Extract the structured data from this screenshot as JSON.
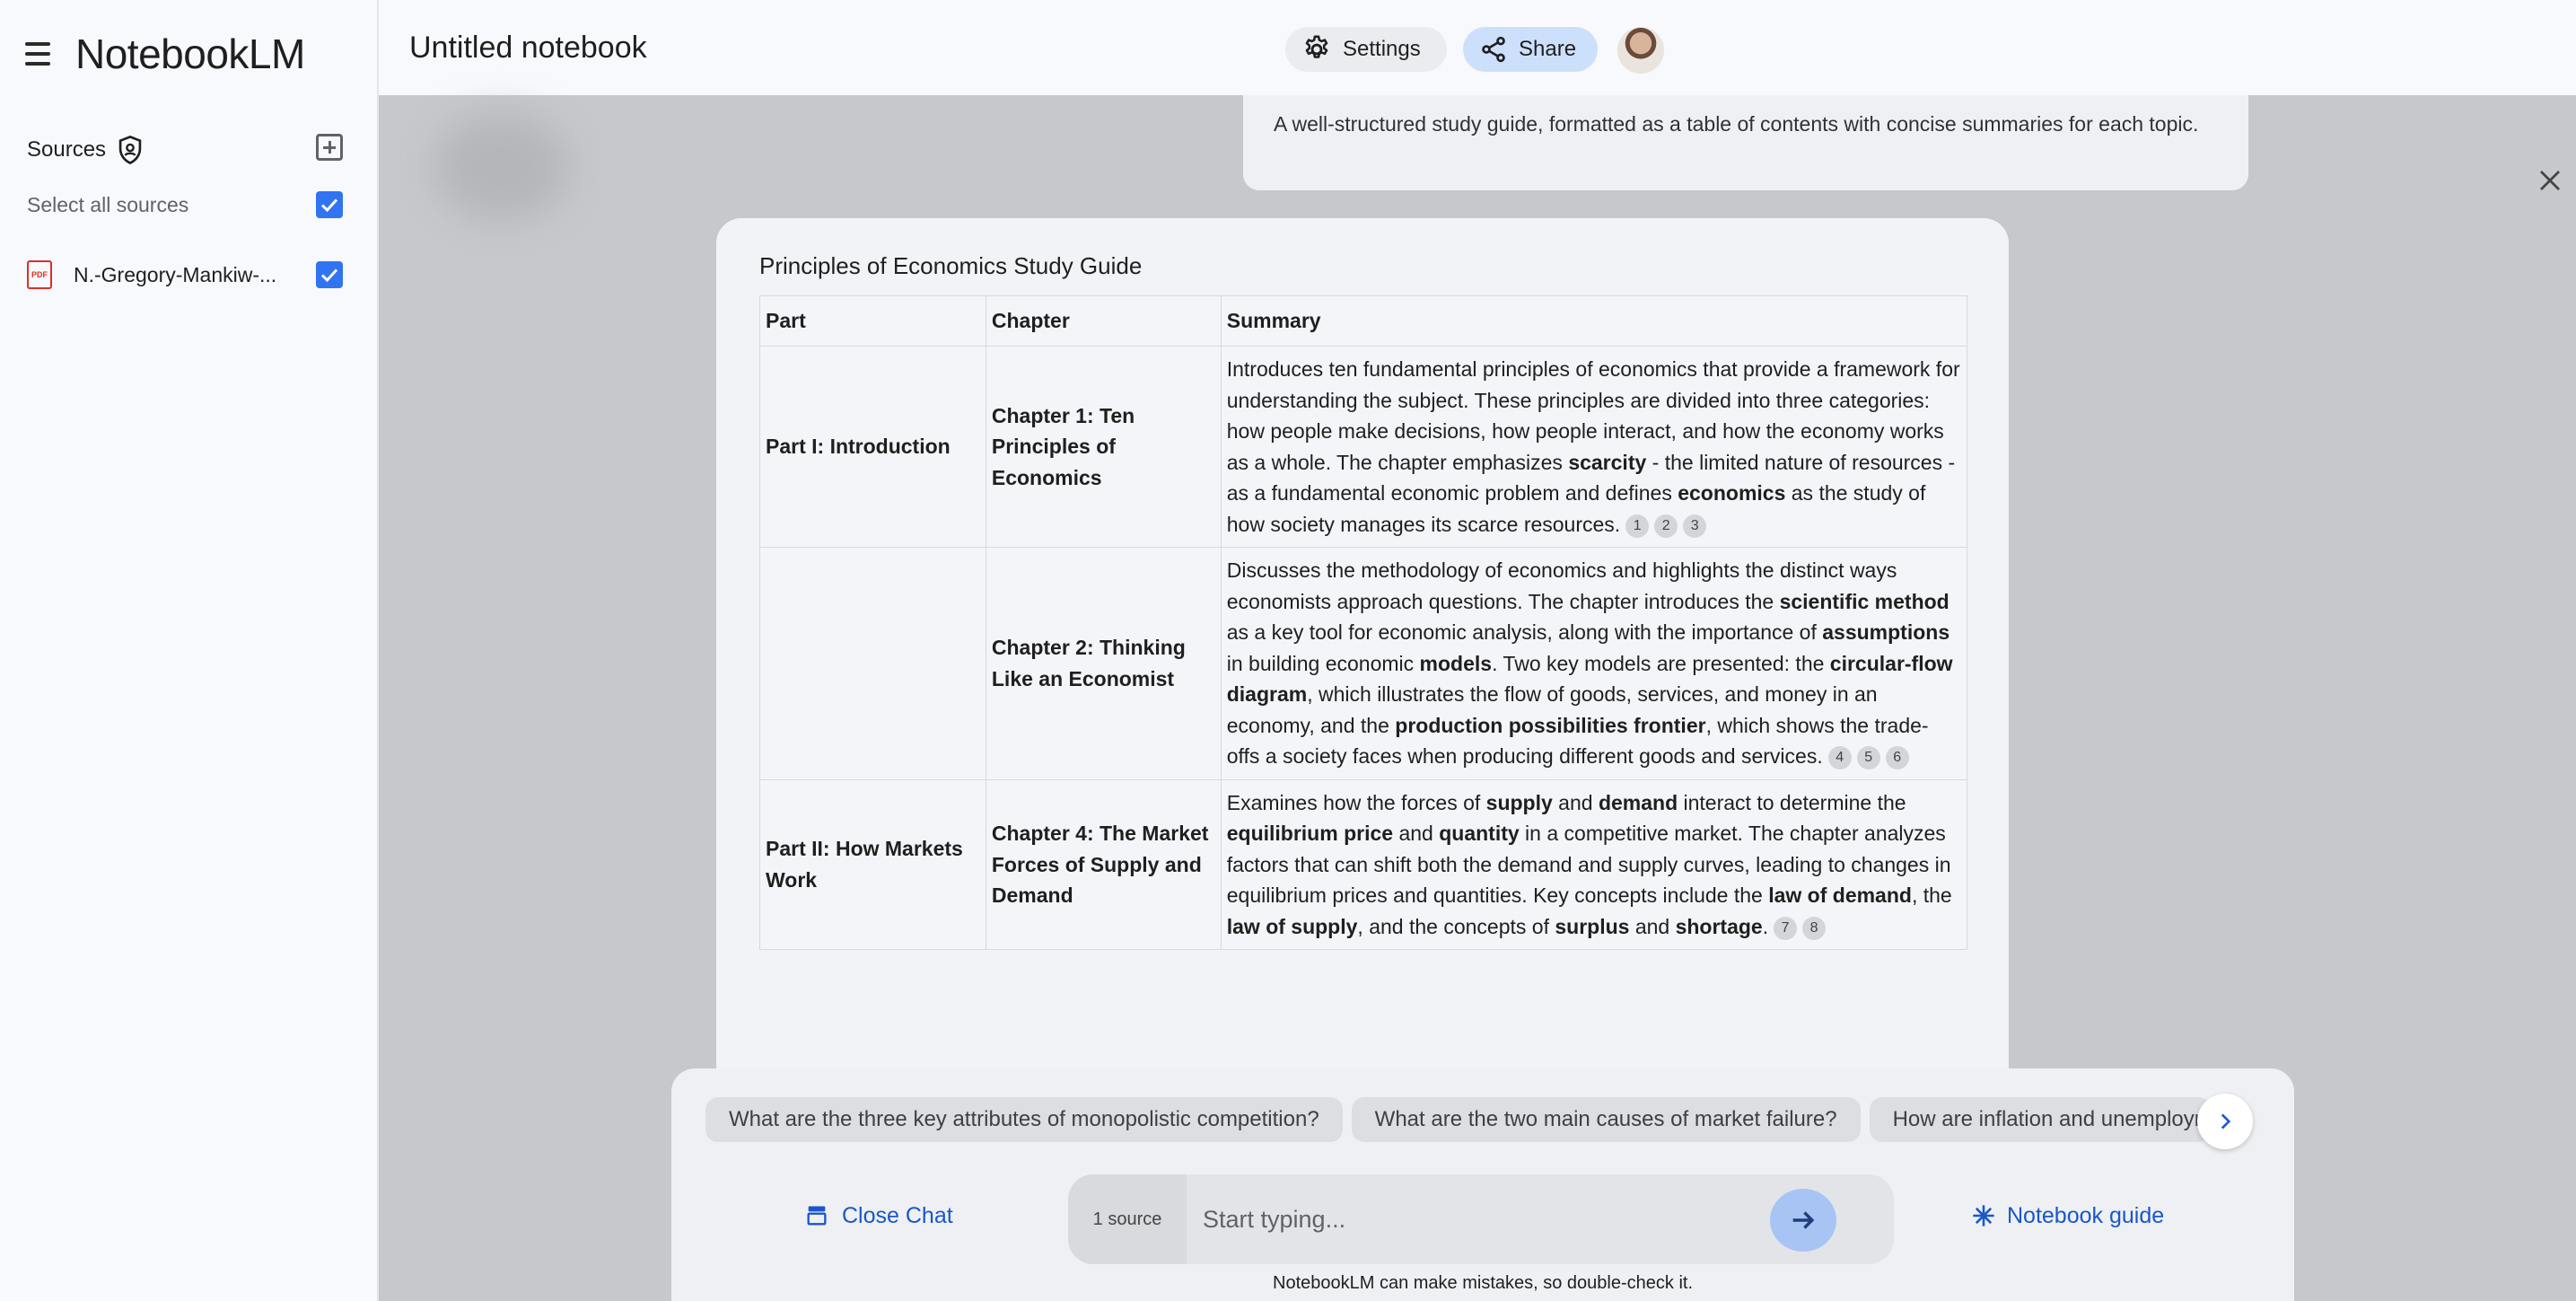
{
  "app": {
    "name": "NotebookLM"
  },
  "sidebar": {
    "sources_label": "Sources",
    "select_all_label": "Select all sources",
    "items": [
      {
        "label": "N.-Gregory-Mankiw-...",
        "type": "PDF",
        "checked": true
      }
    ]
  },
  "topbar": {
    "notebook_title": "Untitled notebook",
    "settings_label": "Settings",
    "share_label": "Share"
  },
  "prompt": {
    "text": "A well-structured study guide, formatted as a table of contents with concise summaries for each topic."
  },
  "guide": {
    "title": "Principles of Economics Study Guide",
    "columns": [
      "Part",
      "Chapter",
      "Summary"
    ],
    "rows": [
      {
        "part": "Part I: Introduction",
        "chapter": "Chapter 1: Ten Principles of Economics",
        "summary": [
          {
            "t": "Introduces ten fundamental principles of economics that provide a framework for understanding the subject. These principles are divided into three categories: how people make decisions, how people interact, and how the economy works as a whole. The chapter emphasizes "
          },
          {
            "t": "scarcity",
            "b": true
          },
          {
            "t": " - the limited nature of resources - as a fundamental economic problem and defines "
          },
          {
            "t": "economics",
            "b": true
          },
          {
            "t": " as the study of how society manages its scarce resources."
          }
        ],
        "citations": [
          "1",
          "2",
          "3"
        ]
      },
      {
        "part": "",
        "chapter": "Chapter 2: Thinking Like an Economist",
        "summary": [
          {
            "t": "Discusses the methodology of economics and highlights the distinct ways economists approach questions. The chapter introduces the "
          },
          {
            "t": "scientific method",
            "b": true
          },
          {
            "t": " as a key tool for economic analysis, along with the importance of "
          },
          {
            "t": "assumptions",
            "b": true
          },
          {
            "t": " in building economic "
          },
          {
            "t": "models",
            "b": true
          },
          {
            "t": ". Two key models are presented: the "
          },
          {
            "t": "circular-flow diagram",
            "b": true
          },
          {
            "t": ", which illustrates the flow of goods, services, and money in an economy, and the "
          },
          {
            "t": "production possibilities frontier",
            "b": true
          },
          {
            "t": ", which shows the trade-offs a society faces when producing different goods and services."
          }
        ],
        "citations": [
          "4",
          "5",
          "6"
        ]
      },
      {
        "part": "Part II: How Markets Work",
        "chapter": "Chapter 4: The Market Forces of Supply and Demand",
        "summary": [
          {
            "t": "Examines how the forces of "
          },
          {
            "t": "supply",
            "b": true
          },
          {
            "t": " and "
          },
          {
            "t": "demand",
            "b": true
          },
          {
            "t": " interact to determine the "
          },
          {
            "t": "equilibrium price",
            "b": true
          },
          {
            "t": " and "
          },
          {
            "t": "quantity",
            "b": true
          },
          {
            "t": " in a competitive market. The chapter analyzes factors that can shift both the demand and supply curves, leading to changes in equilibrium prices and quantities. Key concepts include the "
          },
          {
            "t": "law of demand",
            "b": true
          },
          {
            "t": ", the "
          },
          {
            "t": "law of supply",
            "b": true
          },
          {
            "t": ", and the concepts of "
          },
          {
            "t": "surplus",
            "b": true
          },
          {
            "t": " and "
          },
          {
            "t": "shortage",
            "b": true
          },
          {
            "t": "."
          }
        ],
        "citations": [
          "7",
          "8"
        ]
      }
    ]
  },
  "chat": {
    "suggestions": [
      "What are the three key attributes of monopolistic competition?",
      "What are the two main causes of market failure?",
      "How are inflation and unemploym"
    ],
    "close_chat_label": "Close Chat",
    "source_count": "1 source",
    "input_placeholder": "Start typing...",
    "notebook_guide_label": "Notebook guide",
    "disclaimer": "NotebookLM can make mistakes, so double-check it."
  },
  "colors": {
    "accent": "#1a56c9",
    "checkbox": "#3174f2",
    "share_bg": "#cde0fb"
  }
}
